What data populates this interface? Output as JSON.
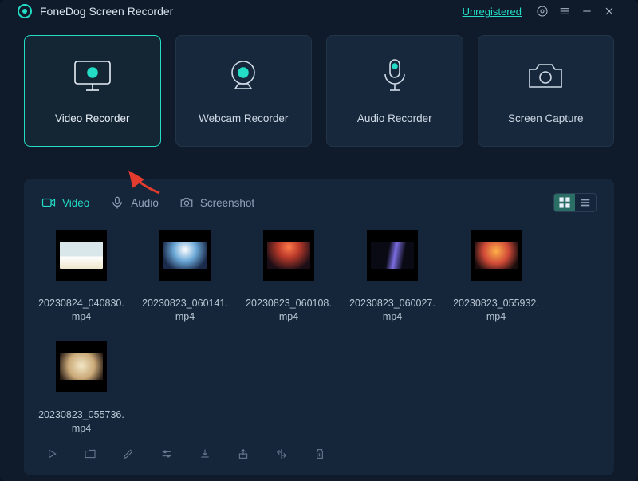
{
  "app": {
    "title": "FoneDog Screen Recorder"
  },
  "titlebar": {
    "unregistered": "Unregistered"
  },
  "modes": {
    "video": "Video Recorder",
    "webcam": "Webcam Recorder",
    "audio": "Audio Recorder",
    "capture": "Screen Capture"
  },
  "library": {
    "tabs": {
      "video": "Video",
      "audio": "Audio",
      "screenshot": "Screenshot"
    },
    "items": [
      {
        "name": "20230824_040830.mp4"
      },
      {
        "name": "20230823_060141.mp4"
      },
      {
        "name": "20230823_060108.mp4"
      },
      {
        "name": "20230823_060027.mp4"
      },
      {
        "name": "20230823_055932.mp4"
      },
      {
        "name": "20230823_055736.mp4"
      }
    ]
  }
}
